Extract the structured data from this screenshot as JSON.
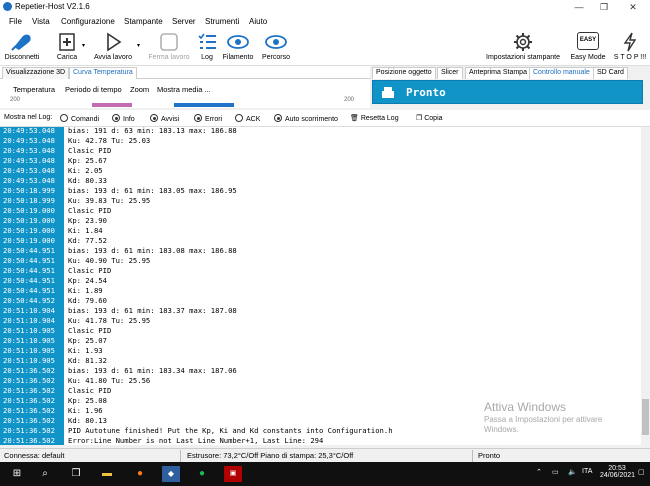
{
  "window": {
    "title": "Repetier-Host V2.1.6",
    "controls": {
      "minimize": "—",
      "maximize": "❐",
      "close": "✕"
    }
  },
  "menu": [
    "File",
    "Vista",
    "Configurazione",
    "Stampante",
    "Server",
    "Strumenti",
    "Aiuto"
  ],
  "toolbar": {
    "disconnect": "Disconnetti",
    "load": "Carica",
    "start_job": "Avvia lavoro",
    "stop_job": "Ferma lavoro",
    "log": "Log",
    "filament": "Filamento",
    "path": "Percorso",
    "printer_settings": "Impostazioni stampante",
    "easy_mode": "Easy Mode",
    "easy_badge": "EASY",
    "stop": "S T O P !!!"
  },
  "left_tabs": [
    "Visualizzazione 3D",
    "Curva Temperatura"
  ],
  "right_tabs": [
    "Posizione oggetto",
    "Slicer",
    "Anteprima Stampa",
    "Controllo manuale",
    "SD Card"
  ],
  "curve_subtabs": [
    "Temperatura",
    "Periodo di tempo",
    "Zoom",
    "Mostra media ..."
  ],
  "curve_axis": [
    "200",
    "200"
  ],
  "printer_status": "Pronto",
  "log_filter": {
    "label": "Mostra nel Log:",
    "items": [
      {
        "label": "Comandi",
        "checked": false
      },
      {
        "label": "Info",
        "checked": true
      },
      {
        "label": "Avvisi",
        "checked": true
      },
      {
        "label": "Errori",
        "checked": true
      },
      {
        "label": "ACK",
        "checked": false
      },
      {
        "label": "Auto scorrimento",
        "checked": true
      }
    ],
    "reset": "Resetta Log",
    "copy": "Copia"
  },
  "log_rows": [
    {
      "time": "20:49:53.048",
      "text": "bias: 191 d: 63 min: 183.13 max: 186.88"
    },
    {
      "time": "20:49:53.048",
      "text": "Ku: 42.78 Tu: 25.03"
    },
    {
      "time": "20:49:53.048",
      "text": "Clasic PID"
    },
    {
      "time": "20:49:53.048",
      "text": "Kp: 25.67"
    },
    {
      "time": "20:49:53.048",
      "text": "Ki: 2.05"
    },
    {
      "time": "20:49:53.048",
      "text": "Kd: 80.33"
    },
    {
      "time": "20:50:18.999",
      "text": "bias: 193 d: 61 min: 183.05 max: 186.95"
    },
    {
      "time": "20:50:18.999",
      "text": "Ku: 39.83 Tu: 25.95"
    },
    {
      "time": "20:50:19.000",
      "text": "Clasic PID"
    },
    {
      "time": "20:50:19.000",
      "text": "Kp: 23.90"
    },
    {
      "time": "20:50:19.000",
      "text": "Ki: 1.84"
    },
    {
      "time": "20:50:19.000",
      "text": "Kd: 77.52"
    },
    {
      "time": "20:50:44.951",
      "text": "bias: 193 d: 61 min: 183.08 max: 186.88"
    },
    {
      "time": "20:50:44.951",
      "text": "Ku: 40.90 Tu: 25.95"
    },
    {
      "time": "20:50:44.951",
      "text": "Clasic PID"
    },
    {
      "time": "20:50:44.951",
      "text": "Kp: 24.54"
    },
    {
      "time": "20:50:44.951",
      "text": "Ki: 1.89"
    },
    {
      "time": "20:50:44.952",
      "text": "Kd: 79.60"
    },
    {
      "time": "20:51:10.904",
      "text": "bias: 193 d: 61 min: 183.37 max: 187.08"
    },
    {
      "time": "20:51:10.904",
      "text": "Ku: 41.78 Tu: 25.95"
    },
    {
      "time": "20:51:10.905",
      "text": "Clasic PID"
    },
    {
      "time": "20:51:10.905",
      "text": "Kp: 25.07"
    },
    {
      "time": "20:51:10.905",
      "text": "Ki: 1.93"
    },
    {
      "time": "20:51:10.905",
      "text": "Kd: 81.32"
    },
    {
      "time": "20:51:36.502",
      "text": "bias: 193 d: 61 min: 183.34 max: 187.06"
    },
    {
      "time": "20:51:36.502",
      "text": "Ku: 41.80 Tu: 25.56"
    },
    {
      "time": "20:51:36.502",
      "text": "Clasic PID"
    },
    {
      "time": "20:51:36.502",
      "text": "Kp: 25.08"
    },
    {
      "time": "20:51:36.502",
      "text": "Ki: 1.96"
    },
    {
      "time": "20:51:36.502",
      "text": "Kd: 80.13"
    },
    {
      "time": "20:51:36.502",
      "text": "PID Autotune finished! Put the Kp, Ki and Kd constants into Configuration.h"
    },
    {
      "time": "20:51:36.502",
      "text": "Error:Line Number is not Last Line Number+1, Last Line: 294"
    }
  ],
  "watermark": {
    "title": "Attiva Windows",
    "line1": "Passa a Impostazioni per attivare",
    "line2": "Windows."
  },
  "statusbar": {
    "connection": "Connessa: default",
    "temps": "Estrusore: 73,2°C/Off Piano di stampa: 25,3°C/Off",
    "state": "Pronto"
  },
  "taskbar": {
    "time": "20:53",
    "date": "24/06/2021",
    "lang": "ITA"
  },
  "colors": {
    "accent": "#1094c8",
    "taskbar": "#101010"
  }
}
